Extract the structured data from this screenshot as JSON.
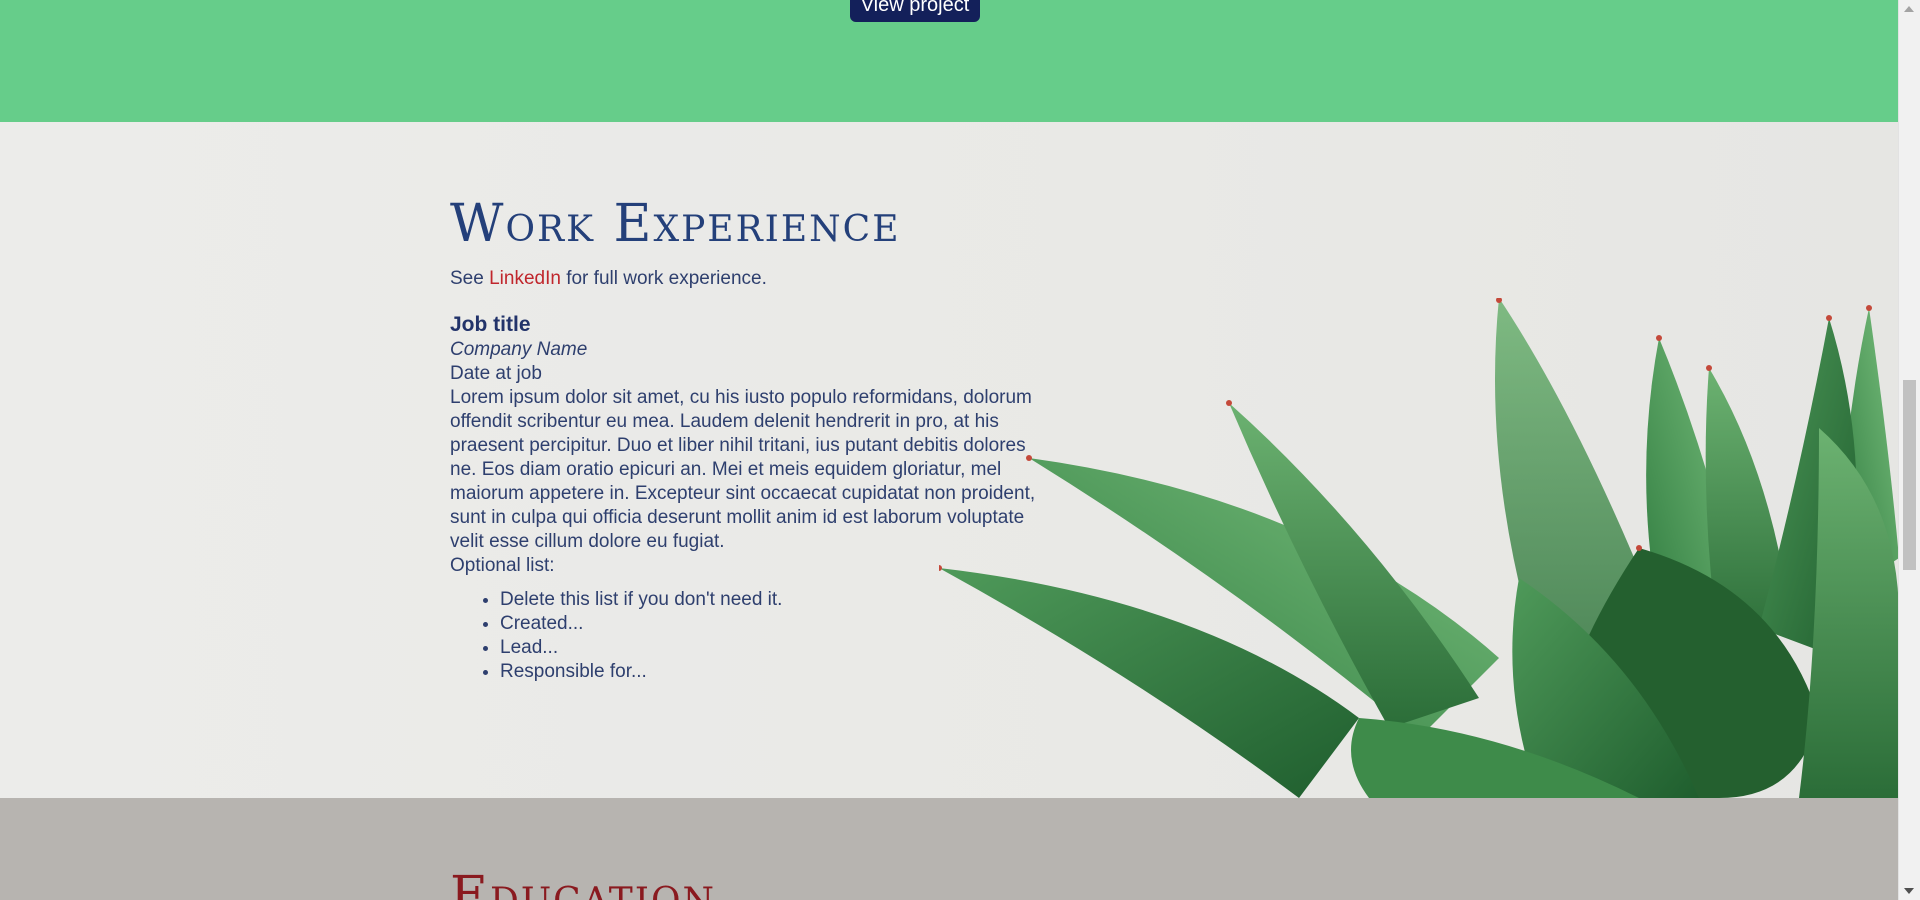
{
  "projects": {
    "button_label": "View project"
  },
  "work": {
    "title": "Work Experience",
    "intro_prefix": "See ",
    "intro_link": "LinkedIn",
    "intro_suffix": " for full work experience.",
    "job": {
      "title": "Job title",
      "company": "Company Name",
      "date": "Date at job",
      "description": "Lorem ipsum dolor sit amet, cu his iusto populo reformidans, dolorum offendit scribentur eu mea. Laudem delenit hendrerit in pro, at his praesent percipitur. Duo et liber nihil tritani, ius putant debitis dolores ne. Eos diam oratio epicuri an. Mei et meis equidem gloriatur, mel maiorum appetere in. Excepteur sint occaecat cupidatat non proident, sunt in culpa qui officia deserunt mollit anim id est laborum voluptate velit esse cillum dolore eu fugiat.",
      "optional_label": "Optional list:",
      "list": [
        "Delete this list if you don't need it.",
        "Created...",
        "Lead...",
        "Responsible for..."
      ]
    }
  },
  "education": {
    "title": "Education"
  },
  "colors": {
    "projects_bg": "#66cd8a",
    "button_bg": "#13205a",
    "work_bg": "#e9e9e6",
    "text": "#2e3f6e",
    "link": "#c0262c",
    "education_bg": "#b7b4b0",
    "education_title": "#8a1a1f"
  }
}
